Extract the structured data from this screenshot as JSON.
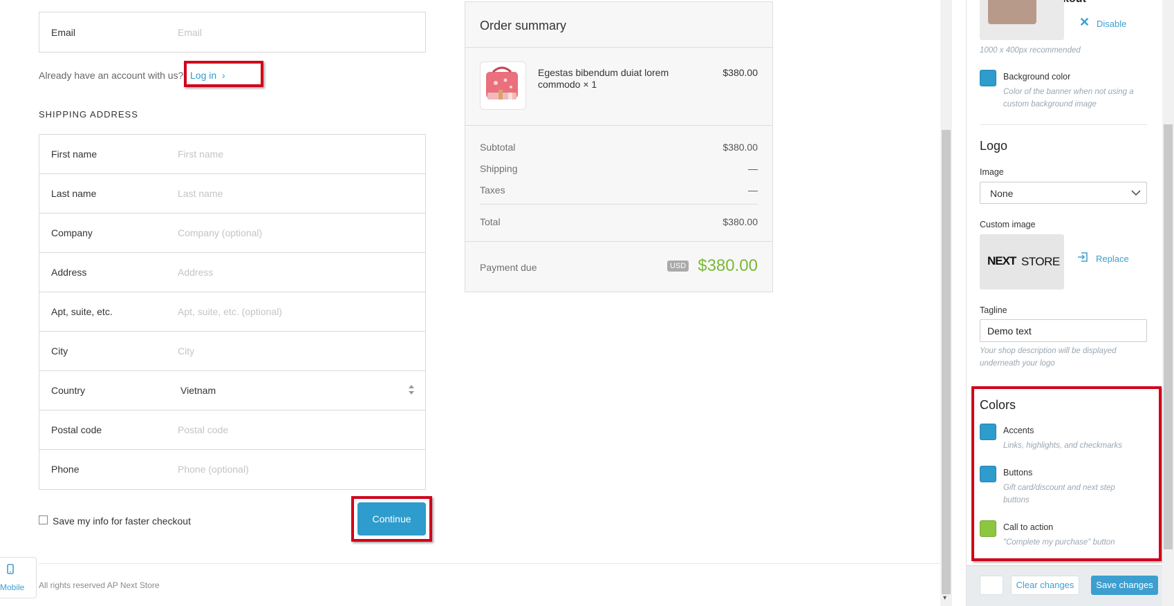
{
  "contact": {
    "email_label": "Email",
    "email_placeholder": "Email",
    "account_prompt": "Already have an account with us?",
    "login_link": "Log in"
  },
  "shipping": {
    "heading": "SHIPPING ADDRESS",
    "fields": [
      {
        "label": "First name",
        "placeholder": "First name"
      },
      {
        "label": "Last name",
        "placeholder": "Last name"
      },
      {
        "label": "Company",
        "placeholder": "Company (optional)"
      },
      {
        "label": "Address",
        "placeholder": "Address"
      },
      {
        "label": "Apt, suite, etc.",
        "placeholder": "Apt, suite, etc. (optional)"
      },
      {
        "label": "City",
        "placeholder": "City"
      },
      {
        "label": "Country",
        "value": "Vietnam"
      },
      {
        "label": "Postal code",
        "placeholder": "Postal code"
      },
      {
        "label": "Phone",
        "placeholder": "Phone (optional)"
      }
    ],
    "save_info_label": "Save my info for faster checkout",
    "continue_label": "Continue"
  },
  "footer": {
    "copyright": "All rights reserved AP Next Store",
    "mobile_label": "Mobile"
  },
  "order_summary": {
    "title": "Order summary",
    "item_name": "Egestas bibendum duiat lorem commodo × 1",
    "item_price": "$380.00",
    "subtotal_label": "Subtotal",
    "subtotal_value": "$380.00",
    "shipping_label": "Shipping",
    "shipping_value": "—",
    "taxes_label": "Taxes",
    "taxes_value": "—",
    "total_label": "Total",
    "total_value": "$380.00",
    "payment_due_label": "Payment due",
    "currency": "USD",
    "payment_due_value": "$380.00"
  },
  "panel": {
    "header_partial": "Checkout",
    "banner": {
      "disable_label": "Disable",
      "size_hint": "1000 x 400px recommended",
      "bg_color_label": "Background color",
      "bg_color_hint": "Color of the banner when not using a custom background image",
      "bg_color": "#2e9ccc"
    },
    "logo": {
      "title": "Logo",
      "image_label": "Image",
      "image_value": "None",
      "custom_image_label": "Custom image",
      "logo_text_1": "NEXT",
      "logo_text_2": "STORE",
      "replace_label": "Replace",
      "tagline_label": "Tagline",
      "tagline_value": "Demo text",
      "tagline_hint": "Your shop description will be displayed underneath your logo"
    },
    "colors": {
      "title": "Colors",
      "items": [
        {
          "label": "Accents",
          "hint": "Links, highlights, and checkmarks",
          "color": "#2e9ccc"
        },
        {
          "label": "Buttons",
          "hint": "Gift card/discount and next step buttons",
          "color": "#2e9ccc"
        },
        {
          "label": "Call to action",
          "hint": "\"Complete my purchase\" button",
          "color": "#8dc63f"
        }
      ]
    },
    "clear_changes_label": "Clear changes",
    "save_changes_label": "Save changes"
  },
  "theme": {
    "accent": "#2e9ccc",
    "price_green": "#7ab838",
    "highlight_red": "#d0021b"
  }
}
